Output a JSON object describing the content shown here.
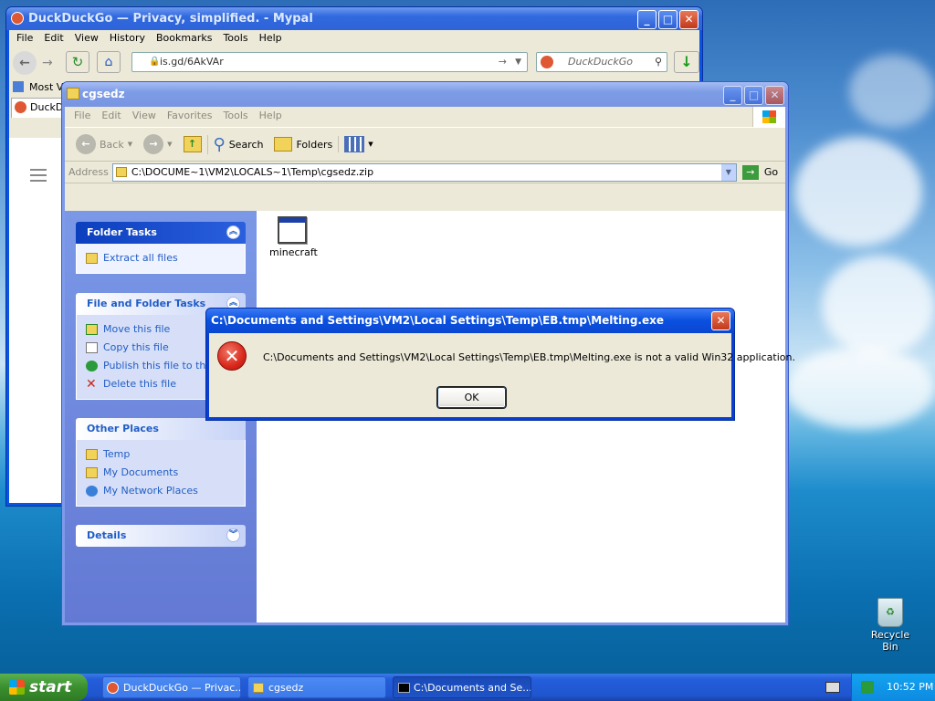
{
  "firefox": {
    "title": "DuckDuckGo — Privacy, simplified. - Mypal",
    "menu": [
      "File",
      "Edit",
      "View",
      "History",
      "Bookmarks",
      "Tools",
      "Help"
    ],
    "url": "is.gd/6AkVAr",
    "search_placeholder": "DuckDuckGo",
    "bookmark_label": "Most Vi",
    "tab_label": "DuckDuck"
  },
  "explorer": {
    "title": "cgsedz",
    "menu": [
      "File",
      "Edit",
      "View",
      "Favorites",
      "Tools",
      "Help"
    ],
    "toolbar": {
      "back": "Back",
      "search": "Search",
      "folders": "Folders"
    },
    "address_label": "Address",
    "address_value": "C:\\DOCUME~1\\VM2\\LOCALS~1\\Temp\\cgsedz.zip",
    "go_label": "Go",
    "panels": {
      "folder_tasks": {
        "title": "Folder Tasks",
        "items": [
          "Extract all files"
        ]
      },
      "file_folder_tasks": {
        "title": "File and Folder Tasks",
        "items": [
          "Move this file",
          "Copy this file",
          "Publish this file to the",
          "Delete this file"
        ]
      },
      "other_places": {
        "title": "Other Places",
        "items": [
          "Temp",
          "My Documents",
          "My Network Places"
        ]
      },
      "details": {
        "title": "Details"
      }
    },
    "files": [
      {
        "name": "minecraft"
      }
    ]
  },
  "dialog": {
    "title": "C:\\Documents and Settings\\VM2\\Local Settings\\Temp\\EB.tmp\\Melting.exe",
    "message": "C:\\Documents and Settings\\VM2\\Local Settings\\Temp\\EB.tmp\\Melting.exe is not a valid Win32 application.",
    "ok_label": "OK"
  },
  "desktop": {
    "recycle_bin": "Recycle Bin"
  },
  "taskbar": {
    "start_label": "start",
    "tasks": [
      "DuckDuckGo — Privac...",
      "cgsedz",
      "C:\\Documents and Se..."
    ],
    "clock": "10:52 PM"
  },
  "colors": {
    "xp_blue": "#0a54e3",
    "error_red": "#d9281c",
    "link_blue": "#215dc6"
  }
}
